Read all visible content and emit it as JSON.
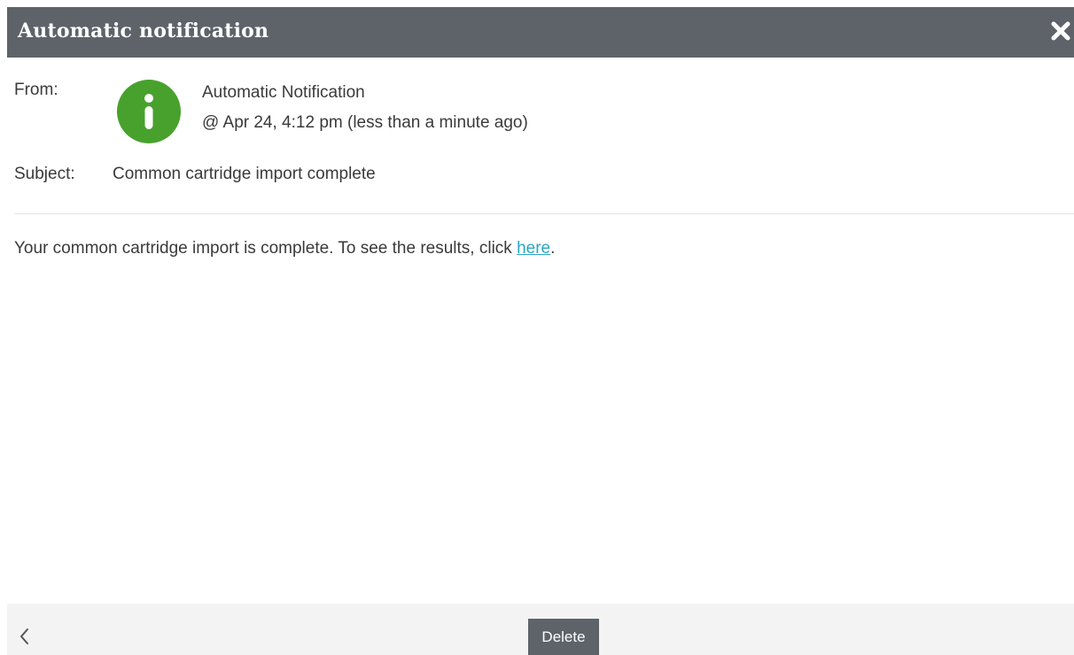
{
  "dialog": {
    "title": "Automatic notification",
    "close_icon": "close-icon"
  },
  "message": {
    "from_label": "From:",
    "sender_name": "Automatic Notification",
    "sender_time": "@ Apr 24, 4:12 pm (less than a minute ago)",
    "avatar_icon": "info-icon",
    "avatar_color": "#48a12d",
    "subject_label": "Subject:",
    "subject": "Common cartridge import complete",
    "body_text": "Your common cartridge import is complete. To see the results, click ",
    "body_link": "here",
    "body_end": "."
  },
  "footer": {
    "back_icon": "chevron-left-icon",
    "delete_label": "Delete"
  },
  "colors": {
    "header_bg": "#5d6369",
    "link": "#2aa6c4",
    "footer_bg": "#f3f3f3"
  }
}
